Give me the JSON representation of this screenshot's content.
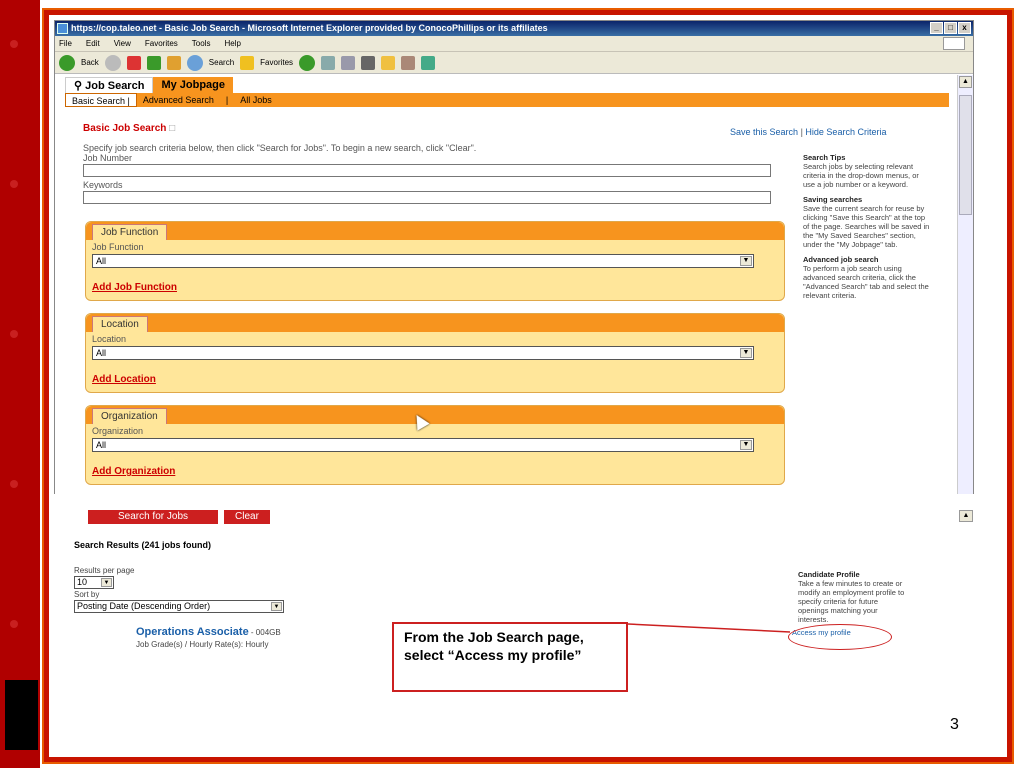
{
  "browser": {
    "title": "https://cop.taleo.net - Basic Job Search - Microsoft Internet Explorer provided by ConocoPhillips or its affiliates",
    "window_buttons": [
      "_",
      "□",
      "x"
    ],
    "menu": [
      "File",
      "Edit",
      "View",
      "Favorites",
      "Tools",
      "Help"
    ],
    "toolbar": {
      "back": "Back",
      "search": "Search",
      "favorites": "Favorites"
    }
  },
  "tabs": {
    "job_search": "Job Search",
    "my_jobpage": "My Jobpage"
  },
  "subnav": [
    "Basic Search |",
    "Advanced Search",
    "|",
    "All Jobs"
  ],
  "search": {
    "title": "Basic Job Search",
    "save_link": "Save this Search",
    "separator": "|",
    "hide_link": "Hide Search Criteria",
    "instructions": "Specify job search criteria below, then click \"Search for Jobs\".  To begin a new search, click \"Clear\".",
    "job_number_label": "Job Number",
    "keywords_label": "Keywords"
  },
  "boxes": [
    {
      "tab": "Job Function",
      "label": "Job Function",
      "value": "All",
      "add": "Add Job Function"
    },
    {
      "tab": "Location",
      "label": "Location",
      "value": "All",
      "add": "Add Location"
    },
    {
      "tab": "Organization",
      "label": "Organization",
      "value": "All",
      "add": "Add Organization"
    }
  ],
  "tips": {
    "h1": "Search Tips",
    "t1": "Search jobs by selecting relevant criteria in the drop-down menus, or use a job number or a keyword.",
    "h2": "Saving searches",
    "t2": "Save the current search for reuse by clicking \"Save this Search\" at the top of the page. Searches will be saved in the \"My Saved Searches\" section, under the \"My Jobpage\" tab.",
    "h3": "Advanced job search",
    "t3": "To perform a job search using advanced search criteria, click the \"Advanced Search\" tab and select the relevant criteria."
  },
  "buttons": {
    "search": "Search for Jobs",
    "clear": "Clear"
  },
  "results": {
    "title": "Search Results (241 jobs found)",
    "per_page_label": "Results per page",
    "per_page_value": "10",
    "sort_label": "Sort by",
    "sort_value": "Posting Date (Descending Order)",
    "job_title": "Operations Associate",
    "job_code": " - 004GB",
    "job_grade": "Job Grade(s) / Hourly Rate(s): Hourly"
  },
  "profile": {
    "title": "Candidate Profile",
    "text": "Take a few minutes to create or modify an employment profile to specify criteria for future openings matching your interests.",
    "link": "Access my profile"
  },
  "callout": "From the Job Search page, select “Access my profile”",
  "slide_number": "3",
  "colors": {
    "accent": "#f7941e",
    "box_bg": "#ffe69a",
    "red": "#cc0000",
    "frame": "#c81400"
  }
}
